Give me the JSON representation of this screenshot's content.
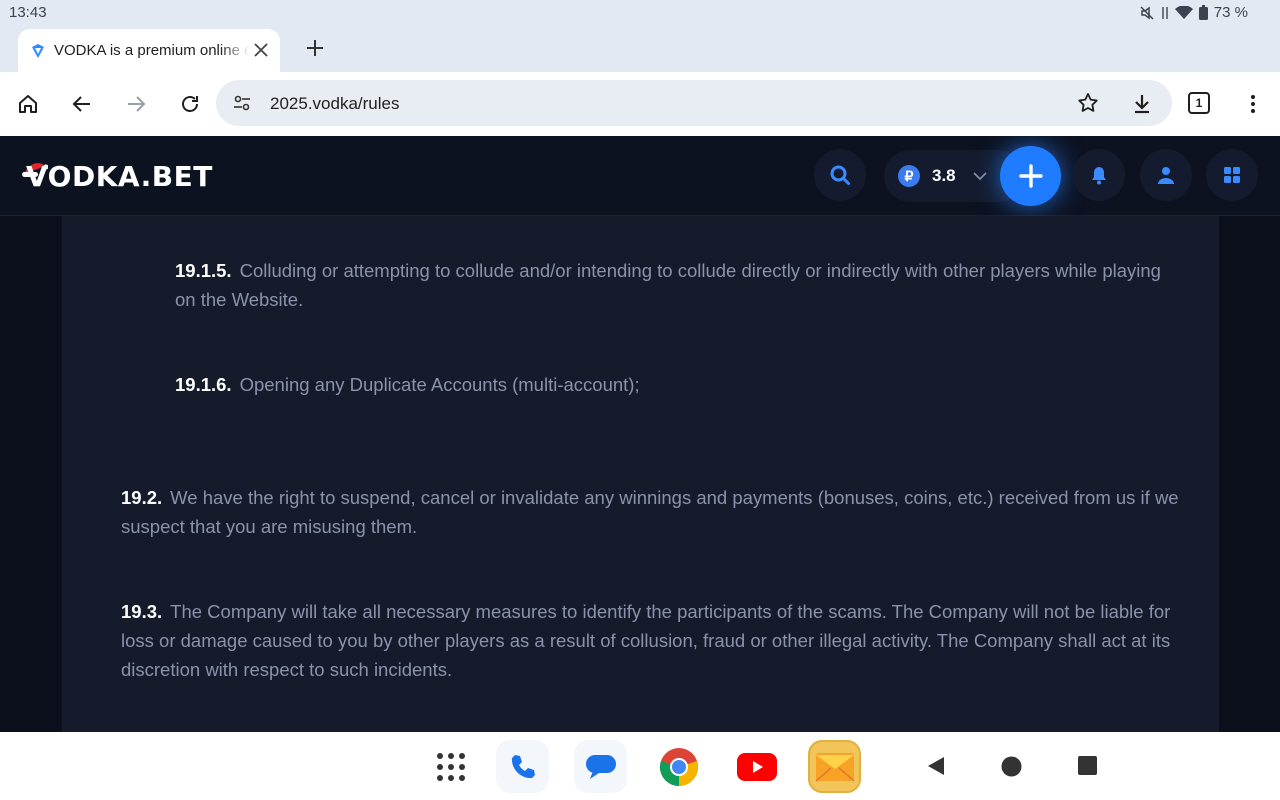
{
  "status_bar": {
    "time": "13:43",
    "battery": "73 %"
  },
  "browser": {
    "tab_title": "VODKA is a premium online casino",
    "url": "2025.vodka/rules",
    "tab_count": "1"
  },
  "site": {
    "logo": "VODKA.BET",
    "balance": "3.8",
    "currency_symbol": "₽"
  },
  "rules": [
    {
      "number": "19.1.5.",
      "text": "Colluding or attempting to collude and/or intending to collude directly or indirectly with other players while playing on the Website."
    },
    {
      "number": "19.1.6.",
      "text": "Opening any Duplicate Accounts (multi-account);"
    },
    {
      "number": "19.2.",
      "text": "We have the right to suspend, cancel or invalidate any winnings and payments (bonuses, coins, etc.) received from us if we suspect that you are misusing them."
    },
    {
      "number": "19.3.",
      "text": "The Company will take all necessary measures to identify the participants of the scams. The Company will not be liable for loss or damage caused to you by other players as a result of collusion, fraud or other illegal activity. The Company shall act at its discretion with respect to such incidents."
    }
  ],
  "colors": {
    "accent": "#1f7bff",
    "site_bg": "#0b0f1c",
    "panel_bg": "#151b2a"
  }
}
